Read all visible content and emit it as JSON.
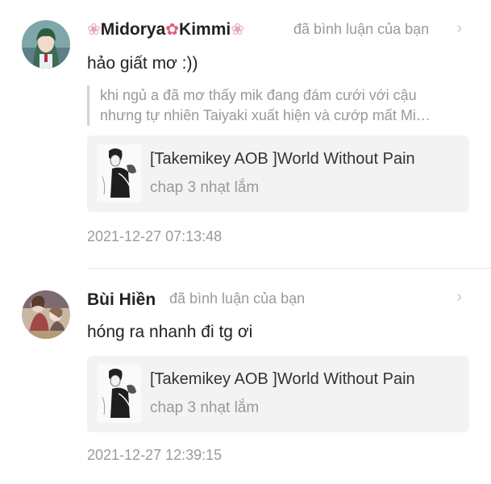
{
  "notifications": [
    {
      "user": {
        "flower_left": "❀",
        "name_a": "Midorya",
        "flower_mid": "✿",
        "name_b": "Kimmi",
        "flower_right": "❀"
      },
      "action": "đã bình luận của bạn",
      "comment": "hảo giất mơ :))",
      "quote": [
        "khi ngủ a đã mơ thấy mik đang đám cưới với cậu",
        "nhưng tự nhiên Taiyaki  xuất hiện và cướp mất Mi…"
      ],
      "story": {
        "title": "[Takemikey AOB ]World Without Pain",
        "chapter": "chap 3 nhạt lắm"
      },
      "time": "2021-12-27 07:13:48"
    },
    {
      "user": {
        "name": "Bùi Hiền"
      },
      "action": "đã bình luận của bạn",
      "comment": "hóng ra nhanh đi tg ơi",
      "story": {
        "title": "[Takemikey AOB ]World Without Pain",
        "chapter": "chap 3 nhạt lắm"
      },
      "time": "2021-12-27 12:39:15"
    }
  ],
  "icons": {
    "chevron": "chevron-right-icon"
  },
  "colors": {
    "muted_text": "#9a9a9a",
    "card_bg": "#f3f3f3",
    "flower_pink": "#e0607a"
  }
}
